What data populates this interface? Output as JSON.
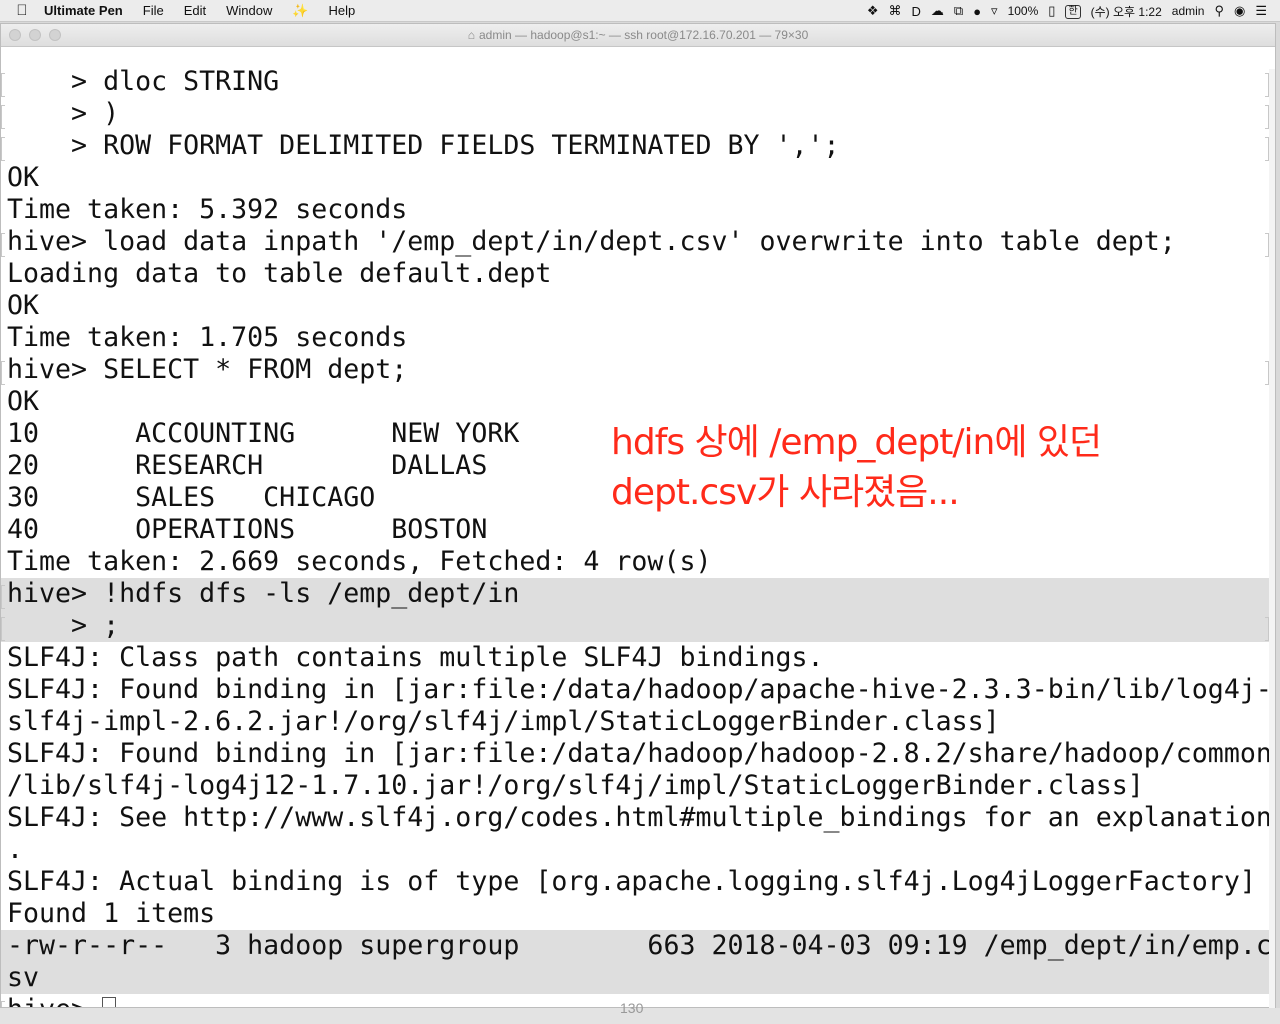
{
  "menubar": {
    "apple_icon": "apple-icon",
    "app_name": "Ultimate Pen",
    "items": [
      "File",
      "Edit",
      "Window",
      "Help"
    ],
    "battery": "100%",
    "ime": "한",
    "clock": "(수) 오후 1:22",
    "user": "admin"
  },
  "window": {
    "title": "admin — hadoop@s1:~ — ssh root@172.16.70.201 — 79×30"
  },
  "terminal": {
    "lines": [
      "    > dloc STRING",
      "    > )",
      "    > ROW FORMAT DELIMITED FIELDS TERMINATED BY ',';",
      "OK",
      "Time taken: 5.392 seconds",
      "hive> load data inpath '/emp_dept/in/dept.csv' overwrite into table dept;",
      "Loading data to table default.dept",
      "OK",
      "Time taken: 1.705 seconds",
      "hive> SELECT * FROM dept;",
      "OK",
      "10      ACCOUNTING      NEW YORK",
      "20      RESEARCH        DALLAS",
      "30      SALES   CHICAGO",
      "40      OPERATIONS      BOSTON",
      "Time taken: 2.669 seconds, Fetched: 4 row(s)",
      "hive> !hdfs dfs -ls /emp_dept/in",
      "    > ;",
      "SLF4J: Class path contains multiple SLF4J bindings.",
      "SLF4J: Found binding in [jar:file:/data/hadoop/apache-hive-2.3.3-bin/lib/log4j-",
      "slf4j-impl-2.6.2.jar!/org/slf4j/impl/StaticLoggerBinder.class]",
      "SLF4J: Found binding in [jar:file:/data/hadoop/hadoop-2.8.2/share/hadoop/common",
      "/lib/slf4j-log4j12-1.7.10.jar!/org/slf4j/impl/StaticLoggerBinder.class]",
      "SLF4J: See http://www.slf4j.org/codes.html#multiple_bindings for an explanation",
      ".",
      "SLF4J: Actual binding is of type [org.apache.logging.slf4j.Log4jLoggerFactory]",
      "Found 1 items",
      "-rw-r--r--   3 hadoop supergroup        663 2018-04-03 09:19 /emp_dept/in/emp.c",
      "sv",
      "hive> "
    ]
  },
  "annotation": {
    "line1": "hdfs 상에 /emp_dept/in에 있던",
    "line2": "dept.csv가  사라졌음...",
    "color": "#ff2a1a"
  },
  "below_window_text": "130"
}
